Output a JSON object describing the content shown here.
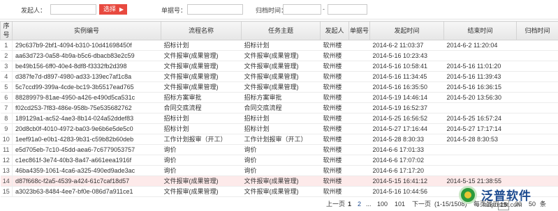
{
  "filter": {
    "initiator_label": "发起人：",
    "select_label": "选择",
    "doc_no_label": "单据号：",
    "archive_time_label": "归档时间：",
    "range_sep": "-"
  },
  "columns": [
    "序号",
    "实例编号",
    "流程名称",
    "任务主题",
    "发起人",
    "单据号",
    "发起时间",
    "结束时间",
    "归档时间"
  ],
  "rows": [
    [
      "1",
      "29c637b9-2bf1-4094-b310-10d41698450f",
      "招标计划",
      "招标计划",
      "软州楼",
      "",
      "2014-6-2 11:03:37",
      "2014-6-2 11:20:04",
      ""
    ],
    [
      "2",
      "aa63d723-0a58-4b9a-b5c6-dbacb83e2c59",
      "文件报审(成果管理)",
      "文件报审(成果管理)",
      "软州楼",
      "",
      "2014-5-16 10:23:43",
      "",
      ""
    ],
    [
      "3",
      "be49b156-6ff0-40e4-8df8-f3332fb2d398",
      "文件报审(成果管理)",
      "文件报审(成果管理)",
      "软州楼",
      "",
      "2014-5-16 10:58:41",
      "2014-5-16 11:01:20",
      ""
    ],
    [
      "4",
      "d387fe7d-d897-4980-ad33-139ec7af1c8a",
      "文件报审(成果管理)",
      "文件报审(成果管理)",
      "软州楼",
      "",
      "2014-5-16 11:34:45",
      "2014-5-16 11:39:43",
      ""
    ],
    [
      "5",
      "5c7ccd99-399a-4cde-bc19-3b5517ead765",
      "文件报审(成果管理)",
      "文件报审(成果管理)",
      "软州楼",
      "",
      "2014-5-16 16:35:50",
      "2014-5-16 16:36:15",
      ""
    ],
    [
      "6",
      "88289979-81ae-4950-a426-e490d5ca531c",
      "招标方案审批",
      "招标方案审批",
      "软州楼",
      "",
      "2014-5-19 14:46:14",
      "2014-5-20 13:56:30",
      ""
    ],
    [
      "7",
      "f02cd253-7f83-486e-958b-75e535682762",
      "合同交底流程",
      "合同交底流程",
      "软州楼",
      "",
      "2014-5-19 16:52:37",
      "",
      ""
    ],
    [
      "8",
      "189129a1-ac52-4ae3-8b14-024a52ddef83",
      "招标计划",
      "招标计划",
      "软州楼",
      "",
      "2014-5-25 16:56:52",
      "2014-5-25 16:57:24",
      ""
    ],
    [
      "9",
      "20d8cb0f-4010-4972-ba03-9e6b6e5de5c0",
      "招标计划",
      "招标计划",
      "软州楼",
      "",
      "2014-5-27 17:16:44",
      "2014-5-27 17:17:14",
      ""
    ],
    [
      "10",
      "1eef91a0-e0b1-4283-9b31-c59b82b60deb",
      "工作计划报审（开工）",
      "工作计划报审（开工）",
      "软州楼",
      "",
      "2014-5-28 8:30:33",
      "2014-5-28 8:30:53",
      ""
    ],
    [
      "11",
      "e5d705eb-7c10-45dd-aea6-7c6779053757",
      "询价",
      "询价",
      "软州楼",
      "",
      "2014-6-6 17:01:33",
      "",
      ""
    ],
    [
      "12",
      "c1ec861f-3e74-40b3-8a47-a661eea1916f",
      "询价",
      "询价",
      "软州楼",
      "",
      "2014-6-6 17:07:02",
      "",
      ""
    ],
    [
      "13",
      "46ba4359-1061-4ca6-a325-490ed9ade3ac",
      "询价",
      "询价",
      "软州楼",
      "",
      "2014-6-6 17:17:20",
      "",
      ""
    ],
    [
      "14",
      "d87f668c-f2a5-4539-a424-61c7caf18d57",
      "文件报审(成果管理)",
      "文件报审(成果管理)",
      "软州楼",
      "",
      "2014-5-15 16:41:12",
      "2014-5-15 21:38:55",
      ""
    ],
    [
      "15",
      "a3023b63-8484-4ee7-bf0e-086d7a911ce1",
      "文件报审(成果管理)",
      "文件报审(成果管理)",
      "软州楼",
      "",
      "2014-5-16 10:44:56",
      "",
      ""
    ]
  ],
  "highlight_row": 14,
  "pager": {
    "prev": "上一页",
    "page1": "1",
    "page2": "2",
    "ellipsis": "...",
    "page100": "100",
    "page101": "101",
    "next": "下一页",
    "range": "(1-15/1508)",
    "per_page_label": "每页显示",
    "size15": "15",
    "size30": "30",
    "size50": "50",
    "unit": "条"
  },
  "brand": {
    "name": "泛普软件",
    "url": "fanpusoft.com"
  },
  "colors": {
    "accent": "#e8493f",
    "highlight_row": "#fdeaea",
    "brand": "#1c4a8f"
  }
}
